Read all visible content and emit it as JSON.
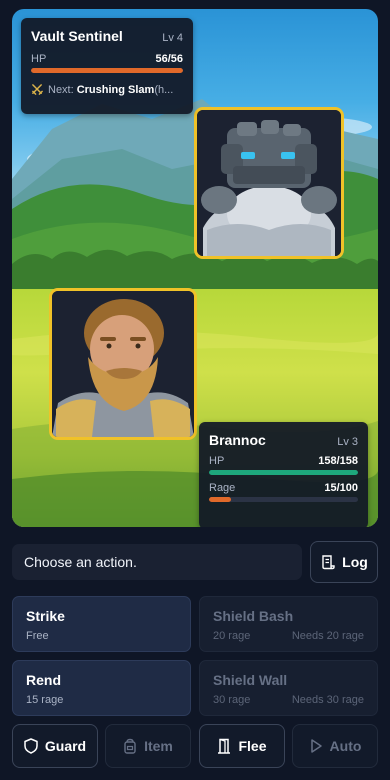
{
  "colors": {
    "accent_gold": "#f0c228",
    "hp_green": "#1ea77c",
    "hp_enemy_orange": "#e0692a",
    "rage_orange": "#e0692a",
    "background": "#0f1626"
  },
  "enemy": {
    "name": "Vault Sentinel",
    "level": "Lv 4",
    "hp_label": "HP",
    "hp_text": "56/56",
    "hp_fraction": 1.0,
    "next_label": "Next:",
    "next_skill": "Crushing Slam",
    "next_hint": " (h...",
    "next_icon": "crossed-swords-icon",
    "portrait": "stone-golem-portrait"
  },
  "player": {
    "name": "Brannoc",
    "level": "Lv 3",
    "hp_label": "HP",
    "hp_text": "158/158",
    "hp_fraction": 1.0,
    "rage_label": "Rage",
    "rage_text": "15/100",
    "rage_fraction": 0.15,
    "portrait": "bearded-warrior-portrait"
  },
  "message": "Choose an action.",
  "log_button": {
    "label": "Log",
    "icon": "scroll-icon"
  },
  "skills": [
    {
      "name": "Strike",
      "cost": "Free",
      "requirement": "",
      "enabled": true
    },
    {
      "name": "Shield Bash",
      "cost": "20 rage",
      "requirement": "Needs 20 rage",
      "enabled": false
    },
    {
      "name": "Rend",
      "cost": "15 rage",
      "requirement": "",
      "enabled": true
    },
    {
      "name": "Shield Wall",
      "cost": "30 rage",
      "requirement": "Needs 30 rage",
      "enabled": false
    }
  ],
  "actions": [
    {
      "label": "Guard",
      "icon": "shield-icon",
      "enabled": true
    },
    {
      "label": "Item",
      "icon": "bag-icon",
      "enabled": false
    },
    {
      "label": "Flee",
      "icon": "door-icon",
      "enabled": true
    },
    {
      "label": "Auto",
      "icon": "play-icon",
      "enabled": false
    }
  ]
}
